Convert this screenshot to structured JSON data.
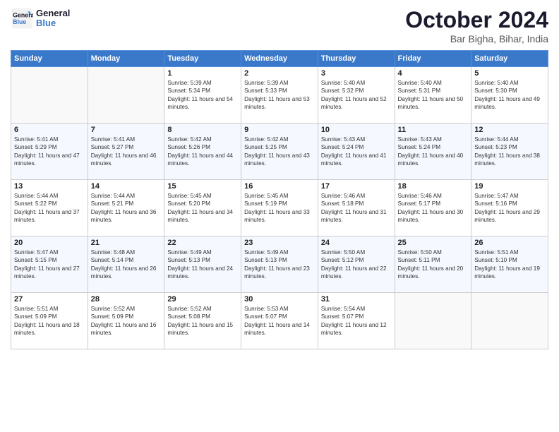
{
  "header": {
    "logo": {
      "line1": "General",
      "line2": "Blue"
    },
    "title": "October 2024",
    "subtitle": "Bar Bigha, Bihar, India"
  },
  "weekdays": [
    "Sunday",
    "Monday",
    "Tuesday",
    "Wednesday",
    "Thursday",
    "Friday",
    "Saturday"
  ],
  "weeks": [
    [
      {
        "day": "",
        "sunrise": "",
        "sunset": "",
        "daylight": ""
      },
      {
        "day": "",
        "sunrise": "",
        "sunset": "",
        "daylight": ""
      },
      {
        "day": "1",
        "sunrise": "Sunrise: 5:39 AM",
        "sunset": "Sunset: 5:34 PM",
        "daylight": "Daylight: 11 hours and 54 minutes."
      },
      {
        "day": "2",
        "sunrise": "Sunrise: 5:39 AM",
        "sunset": "Sunset: 5:33 PM",
        "daylight": "Daylight: 11 hours and 53 minutes."
      },
      {
        "day": "3",
        "sunrise": "Sunrise: 5:40 AM",
        "sunset": "Sunset: 5:32 PM",
        "daylight": "Daylight: 11 hours and 52 minutes."
      },
      {
        "day": "4",
        "sunrise": "Sunrise: 5:40 AM",
        "sunset": "Sunset: 5:31 PM",
        "daylight": "Daylight: 11 hours and 50 minutes."
      },
      {
        "day": "5",
        "sunrise": "Sunrise: 5:40 AM",
        "sunset": "Sunset: 5:30 PM",
        "daylight": "Daylight: 11 hours and 49 minutes."
      }
    ],
    [
      {
        "day": "6",
        "sunrise": "Sunrise: 5:41 AM",
        "sunset": "Sunset: 5:29 PM",
        "daylight": "Daylight: 11 hours and 47 minutes."
      },
      {
        "day": "7",
        "sunrise": "Sunrise: 5:41 AM",
        "sunset": "Sunset: 5:27 PM",
        "daylight": "Daylight: 11 hours and 46 minutes."
      },
      {
        "day": "8",
        "sunrise": "Sunrise: 5:42 AM",
        "sunset": "Sunset: 5:26 PM",
        "daylight": "Daylight: 11 hours and 44 minutes."
      },
      {
        "day": "9",
        "sunrise": "Sunrise: 5:42 AM",
        "sunset": "Sunset: 5:25 PM",
        "daylight": "Daylight: 11 hours and 43 minutes."
      },
      {
        "day": "10",
        "sunrise": "Sunrise: 5:43 AM",
        "sunset": "Sunset: 5:24 PM",
        "daylight": "Daylight: 11 hours and 41 minutes."
      },
      {
        "day": "11",
        "sunrise": "Sunrise: 5:43 AM",
        "sunset": "Sunset: 5:24 PM",
        "daylight": "Daylight: 11 hours and 40 minutes."
      },
      {
        "day": "12",
        "sunrise": "Sunrise: 5:44 AM",
        "sunset": "Sunset: 5:23 PM",
        "daylight": "Daylight: 11 hours and 38 minutes."
      }
    ],
    [
      {
        "day": "13",
        "sunrise": "Sunrise: 5:44 AM",
        "sunset": "Sunset: 5:22 PM",
        "daylight": "Daylight: 11 hours and 37 minutes."
      },
      {
        "day": "14",
        "sunrise": "Sunrise: 5:44 AM",
        "sunset": "Sunset: 5:21 PM",
        "daylight": "Daylight: 11 hours and 36 minutes."
      },
      {
        "day": "15",
        "sunrise": "Sunrise: 5:45 AM",
        "sunset": "Sunset: 5:20 PM",
        "daylight": "Daylight: 11 hours and 34 minutes."
      },
      {
        "day": "16",
        "sunrise": "Sunrise: 5:45 AM",
        "sunset": "Sunset: 5:19 PM",
        "daylight": "Daylight: 11 hours and 33 minutes."
      },
      {
        "day": "17",
        "sunrise": "Sunrise: 5:46 AM",
        "sunset": "Sunset: 5:18 PM",
        "daylight": "Daylight: 11 hours and 31 minutes."
      },
      {
        "day": "18",
        "sunrise": "Sunrise: 5:46 AM",
        "sunset": "Sunset: 5:17 PM",
        "daylight": "Daylight: 11 hours and 30 minutes."
      },
      {
        "day": "19",
        "sunrise": "Sunrise: 5:47 AM",
        "sunset": "Sunset: 5:16 PM",
        "daylight": "Daylight: 11 hours and 29 minutes."
      }
    ],
    [
      {
        "day": "20",
        "sunrise": "Sunrise: 5:47 AM",
        "sunset": "Sunset: 5:15 PM",
        "daylight": "Daylight: 11 hours and 27 minutes."
      },
      {
        "day": "21",
        "sunrise": "Sunrise: 5:48 AM",
        "sunset": "Sunset: 5:14 PM",
        "daylight": "Daylight: 11 hours and 26 minutes."
      },
      {
        "day": "22",
        "sunrise": "Sunrise: 5:49 AM",
        "sunset": "Sunset: 5:13 PM",
        "daylight": "Daylight: 11 hours and 24 minutes."
      },
      {
        "day": "23",
        "sunrise": "Sunrise: 5:49 AM",
        "sunset": "Sunset: 5:13 PM",
        "daylight": "Daylight: 11 hours and 23 minutes."
      },
      {
        "day": "24",
        "sunrise": "Sunrise: 5:50 AM",
        "sunset": "Sunset: 5:12 PM",
        "daylight": "Daylight: 11 hours and 22 minutes."
      },
      {
        "day": "25",
        "sunrise": "Sunrise: 5:50 AM",
        "sunset": "Sunset: 5:11 PM",
        "daylight": "Daylight: 11 hours and 20 minutes."
      },
      {
        "day": "26",
        "sunrise": "Sunrise: 5:51 AM",
        "sunset": "Sunset: 5:10 PM",
        "daylight": "Daylight: 11 hours and 19 minutes."
      }
    ],
    [
      {
        "day": "27",
        "sunrise": "Sunrise: 5:51 AM",
        "sunset": "Sunset: 5:09 PM",
        "daylight": "Daylight: 11 hours and 18 minutes."
      },
      {
        "day": "28",
        "sunrise": "Sunrise: 5:52 AM",
        "sunset": "Sunset: 5:09 PM",
        "daylight": "Daylight: 11 hours and 16 minutes."
      },
      {
        "day": "29",
        "sunrise": "Sunrise: 5:52 AM",
        "sunset": "Sunset: 5:08 PM",
        "daylight": "Daylight: 11 hours and 15 minutes."
      },
      {
        "day": "30",
        "sunrise": "Sunrise: 5:53 AM",
        "sunset": "Sunset: 5:07 PM",
        "daylight": "Daylight: 11 hours and 14 minutes."
      },
      {
        "day": "31",
        "sunrise": "Sunrise: 5:54 AM",
        "sunset": "Sunset: 5:07 PM",
        "daylight": "Daylight: 11 hours and 12 minutes."
      },
      {
        "day": "",
        "sunrise": "",
        "sunset": "",
        "daylight": ""
      },
      {
        "day": "",
        "sunrise": "",
        "sunset": "",
        "daylight": ""
      }
    ]
  ]
}
